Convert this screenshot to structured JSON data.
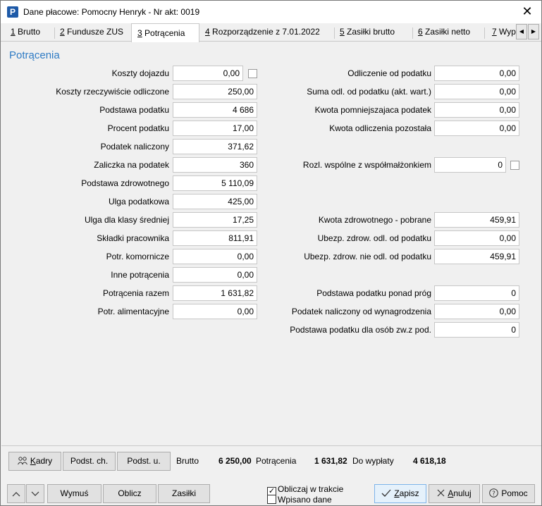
{
  "window": {
    "title": "Dane płacowe: Pomocny Henryk - Nr akt: 0019",
    "close_glyph": "✕"
  },
  "tabs": [
    {
      "num": "1",
      "label": " Brutto"
    },
    {
      "num": "2",
      "label": " Fundusze ZUS"
    },
    {
      "num": "3",
      "label": " Potrącenia"
    },
    {
      "num": "4",
      "label": " Rozporządzenie z 7.01.2022"
    },
    {
      "num": "5",
      "label": " Zasiłki brutto"
    },
    {
      "num": "6",
      "label": " Zasiłki netto"
    },
    {
      "num": "7",
      "label": " Wyp"
    }
  ],
  "section_title": "Potrącenia",
  "left_fields": [
    {
      "label": "Koszty dojazdu",
      "value": "0,00"
    },
    {
      "label": "Koszty rzeczywiście odliczone",
      "value": "250,00"
    },
    {
      "label": "Podstawa podatku",
      "value": "4 686"
    },
    {
      "label": "Procent podatku",
      "value": "17,00"
    },
    {
      "label": "Podatek naliczony",
      "value": "371,62"
    },
    {
      "label": "Zaliczka na podatek",
      "value": "360"
    },
    {
      "label": "Podstawa zdrowotnego",
      "value": "5 110,09"
    },
    {
      "label": "Ulga podatkowa",
      "value": "425,00"
    },
    {
      "label": "Ulga dla klasy średniej",
      "value": "17,25"
    },
    {
      "label": "Składki pracownika",
      "value": "811,91"
    },
    {
      "label": "Potr. komornicze",
      "value": "0,00"
    },
    {
      "label": "Inne potrącenia",
      "value": "0,00"
    },
    {
      "label": "Potrącenia razem",
      "value": "1 631,82"
    },
    {
      "label": "Potr. alimentacyjne",
      "value": "0,00"
    }
  ],
  "right_fields": [
    {
      "label": "Odliczenie od podatku",
      "value": "0,00"
    },
    {
      "label": "Suma odl. od podatku (akt. wart.)",
      "value": "0,00"
    },
    {
      "label": "Kwota pomniejszajaca podatek",
      "value": "0,00"
    },
    {
      "label": "Kwota odliczenia pozostała",
      "value": "0,00"
    },
    {
      "label": "Rozl. wspólne z współmałżonkiem",
      "value": "0"
    },
    {
      "label": "Kwota zdrowotnego - pobrane",
      "value": "459,91"
    },
    {
      "label": "Ubezp. zdrow. odl. od podatku",
      "value": "0,00"
    },
    {
      "label": "Ubezp. zdrow. nie odl. od podatku",
      "value": "459,91"
    },
    {
      "label": "Podstawa podatku ponad próg",
      "value": "0"
    },
    {
      "label": "Podatek naliczony od wynagrodzenia",
      "value": "0,00"
    },
    {
      "label": "Podstawa podatku dla osób zw.z pod.",
      "value": "0"
    }
  ],
  "bottom_buttons": {
    "kadry": {
      "u": "K",
      "rest": "adry"
    },
    "podst_ch": "Podst. ch.",
    "podst_u": "Podst. u."
  },
  "summary": {
    "brutto_label": "Brutto",
    "brutto_value": "6 250,00",
    "potracenia_label": "Potrącenia",
    "potracenia_value": "1 631,82",
    "do_wyplaty_label": "Do wypłaty",
    "do_wyplaty_value": "4 618,18"
  },
  "footer": {
    "wymus": "Wymuś",
    "oblicz": "Oblicz",
    "zasilki": "Zasiłki",
    "oblicz_w_trakcie": {
      "label": "Obliczaj w trakcie",
      "checked": true
    },
    "wpisano_dane": {
      "label": "Wpisano dane",
      "checked": false
    },
    "zapisz": {
      "u": "Z",
      "rest": "apisz"
    },
    "anuluj": {
      "u": "A",
      "rest": "nuluj"
    },
    "pomoc": "Pomoc"
  },
  "colors": {
    "section_title": "#2f7bc4",
    "app_icon": "#1e5aa8",
    "primary_button_bg": "#e5f1fb"
  },
  "icons": [
    "app-icon",
    "close-icon",
    "chevron-left-icon",
    "chevron-right-icon",
    "people-icon",
    "chevron-up-icon",
    "chevron-down-icon",
    "checkmark-icon",
    "x-icon",
    "help-icon"
  ]
}
